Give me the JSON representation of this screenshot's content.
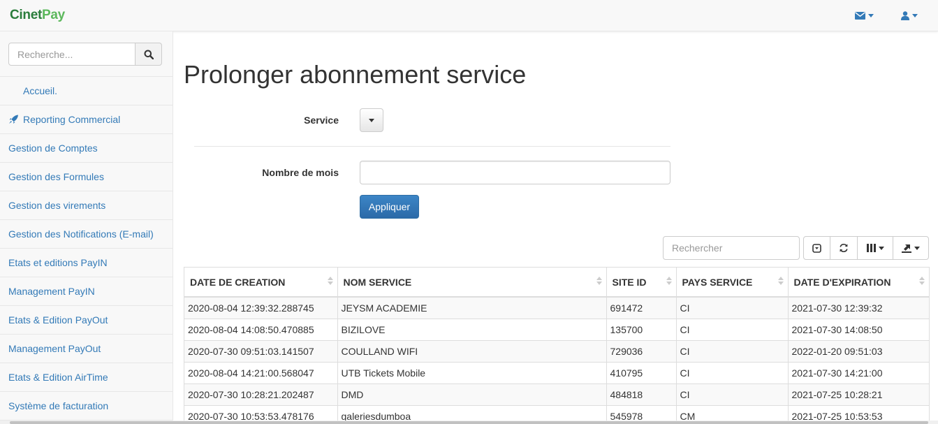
{
  "brand": {
    "part1": "Cinet",
    "part2": "Pay"
  },
  "navbar": {
    "mail_icon": "envelope-icon",
    "user_icon": "user-icon"
  },
  "sidebar": {
    "search_placeholder": "Recherche...",
    "items": [
      {
        "label": "Accueil."
      },
      {
        "label": "Reporting Commercial",
        "icon": "rocket-icon"
      },
      {
        "label": "Gestion de Comptes"
      },
      {
        "label": "Gestion des Formules"
      },
      {
        "label": "Gestion des virements"
      },
      {
        "label": "Gestion des Notifications (E-mail)"
      },
      {
        "label": "Etats et editions PayIN"
      },
      {
        "label": "Management PayIN"
      },
      {
        "label": "Etats & Edition PayOut"
      },
      {
        "label": "Management PayOut"
      },
      {
        "label": "Etats & Edition AirTime"
      },
      {
        "label": "Système de facturation"
      }
    ]
  },
  "main": {
    "title": "Prolonger abonnement service",
    "form": {
      "service_label": "Service",
      "months_label": "Nombre de mois",
      "months_value": "",
      "apply_label": "Appliquer"
    },
    "table": {
      "search_placeholder": "Rechercher",
      "columns": [
        "DATE DE CREATION",
        "NOM SERVICE",
        "SITE ID",
        "PAYS SERVICE",
        "DATE D'EXPIRATION"
      ],
      "rows": [
        [
          "2020-08-04 12:39:32.288745",
          "JEYSM ACADEMIE",
          "691472",
          "CI",
          "2021-07-30 12:39:32"
        ],
        [
          "2020-08-04 14:08:50.470885",
          "BIZILOVE",
          "135700",
          "CI",
          "2021-07-30 14:08:50"
        ],
        [
          "2020-07-30 09:51:03.141507",
          "COULLAND WIFI",
          "729036",
          "CI",
          "2022-01-20 09:51:03"
        ],
        [
          "2020-08-04 14:21:00.568047",
          "UTB Tickets Mobile",
          "410795",
          "CI",
          "2021-07-30 14:21:00"
        ],
        [
          "2020-07-30 10:28:21.202487",
          "DMD",
          "484818",
          "CI",
          "2021-07-25 10:28:21"
        ],
        [
          "2020-07-30 10:53:53.478176",
          "galeriesdumboa",
          "545978",
          "CM",
          "2021-07-25 10:53:53"
        ]
      ]
    }
  },
  "colors": {
    "link": "#337ab7",
    "primary_button": "#337ab7",
    "brand_dark": "#2a7d3b",
    "brand_light": "#5cb85c"
  }
}
